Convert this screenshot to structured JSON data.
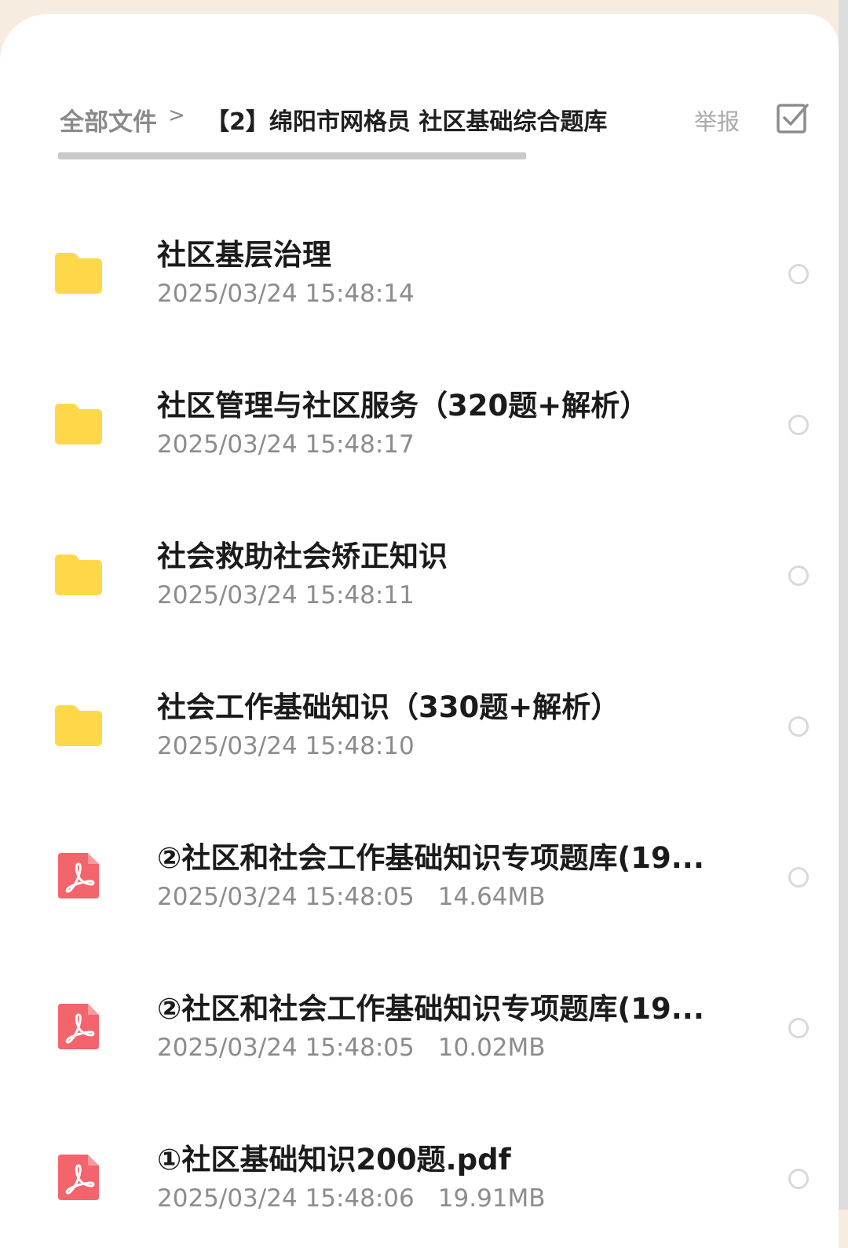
{
  "header": {
    "breadcrumb_root": "全部文件",
    "breadcrumb_separator": ">",
    "breadcrumb_current": "【2】绵阳市网格员 社区基础综合题库",
    "report_label": "举报",
    "select_icon": "checkbox-check-icon"
  },
  "colors": {
    "folder": "#ffd84a",
    "pdf": "#f3646d",
    "title_text": "#1b1b1b",
    "meta_text": "#8c8c8c"
  },
  "files": [
    {
      "type": "folder",
      "icon": "folder-icon",
      "name": "社区基层治理",
      "date": "2025/03/24 15:48:14",
      "size": ""
    },
    {
      "type": "folder",
      "icon": "folder-icon",
      "name": "社区管理与社区服务（320题+解析）",
      "date": "2025/03/24 15:48:17",
      "size": ""
    },
    {
      "type": "folder",
      "icon": "folder-icon",
      "name": "社会救助社会矫正知识",
      "date": "2025/03/24 15:48:11",
      "size": ""
    },
    {
      "type": "folder",
      "icon": "folder-icon",
      "name": "社会工作基础知识（330题+解析）",
      "date": "2025/03/24 15:48:10",
      "size": ""
    },
    {
      "type": "pdf",
      "icon": "pdf-icon",
      "name": "②社区和社会工作基础知识专项题库(19...",
      "date": "2025/03/24 15:48:05",
      "size": "14.64MB"
    },
    {
      "type": "pdf",
      "icon": "pdf-icon",
      "name": "②社区和社会工作基础知识专项题库(19...",
      "date": "2025/03/24 15:48:05",
      "size": "10.02MB"
    },
    {
      "type": "pdf",
      "icon": "pdf-icon",
      "name": "①社区基础知识200题.pdf",
      "date": "2025/03/24 15:48:06",
      "size": "19.91MB"
    }
  ]
}
